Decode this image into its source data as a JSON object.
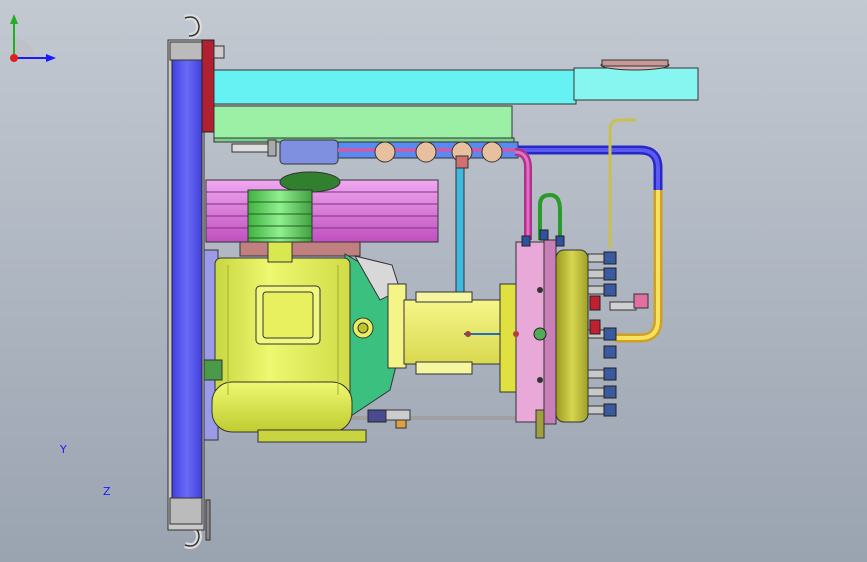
{
  "view": {
    "type": "3D CAD assembly view",
    "subject": "compressor unit"
  },
  "triad": {
    "y_label": "Y",
    "z_label": "Z",
    "y_color": "#1a1aff",
    "z_color": "#1a1aff",
    "y_axis_color": "#20b020",
    "z_axis_color": "#1a1aff",
    "origin_color": "#e02020"
  },
  "colors": {
    "background": "#b2bac5",
    "frame_blue": "#5555ee",
    "cyan_beam": "#66f0f0",
    "green_beam": "#99f0a0",
    "pulley_magenta": "#e080e0",
    "pulley_green": "#70dd70",
    "motor_yellow": "#e8f560",
    "cylinder_yellow": "#f0f070",
    "flange_pink": "#e8a8d8",
    "head_olive": "#c8c840",
    "pipe_blue": "#3030d0",
    "pipe_yellow": "#f0d040",
    "pipe_magenta": "#c040a0"
  }
}
